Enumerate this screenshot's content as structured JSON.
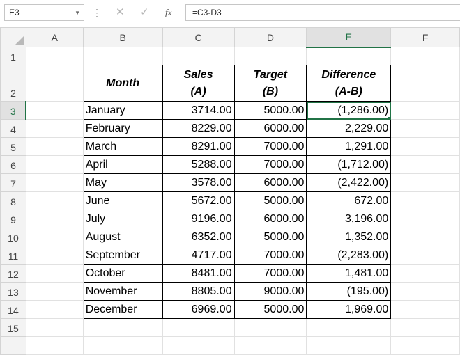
{
  "formula_bar": {
    "name_box": "E3",
    "cancel_glyph": "✕",
    "enter_glyph": "✓",
    "fx_label": "fx",
    "formula": "=C3-D3"
  },
  "columns": [
    "A",
    "B",
    "C",
    "D",
    "E",
    "F"
  ],
  "header_row": {
    "month": "Month",
    "sales": [
      "Sales",
      "(A)"
    ],
    "target": [
      "Target",
      "(B)"
    ],
    "difference": [
      "Difference",
      "(A-B)"
    ]
  },
  "rows": [
    {
      "row": "3",
      "month": "January",
      "sales": "3714.00",
      "target": "5000.00",
      "difference": "(1,286.00)"
    },
    {
      "row": "4",
      "month": "February",
      "sales": "8229.00",
      "target": "6000.00",
      "difference": "2,229.00"
    },
    {
      "row": "5",
      "month": "March",
      "sales": "8291.00",
      "target": "7000.00",
      "difference": "1,291.00"
    },
    {
      "row": "6",
      "month": "April",
      "sales": "5288.00",
      "target": "7000.00",
      "difference": "(1,712.00)"
    },
    {
      "row": "7",
      "month": "May",
      "sales": "3578.00",
      "target": "6000.00",
      "difference": "(2,422.00)"
    },
    {
      "row": "8",
      "month": "June",
      "sales": "5672.00",
      "target": "5000.00",
      "difference": "672.00"
    },
    {
      "row": "9",
      "month": "July",
      "sales": "9196.00",
      "target": "6000.00",
      "difference": "3,196.00"
    },
    {
      "row": "10",
      "month": "August",
      "sales": "6352.00",
      "target": "5000.00",
      "difference": "1,352.00"
    },
    {
      "row": "11",
      "month": "September",
      "sales": "4717.00",
      "target": "7000.00",
      "difference": "(2,283.00)"
    },
    {
      "row": "12",
      "month": "October",
      "sales": "8481.00",
      "target": "7000.00",
      "difference": "1,481.00"
    },
    {
      "row": "13",
      "month": "November",
      "sales": "8805.00",
      "target": "9000.00",
      "difference": "(195.00)"
    },
    {
      "row": "14",
      "month": "December",
      "sales": "6969.00",
      "target": "5000.00",
      "difference": "1,969.00"
    }
  ],
  "row_labels": {
    "r1": "1",
    "r2": "2",
    "r15": "15"
  },
  "colors": {
    "selection": "#217346",
    "negative": "#ff0000"
  }
}
